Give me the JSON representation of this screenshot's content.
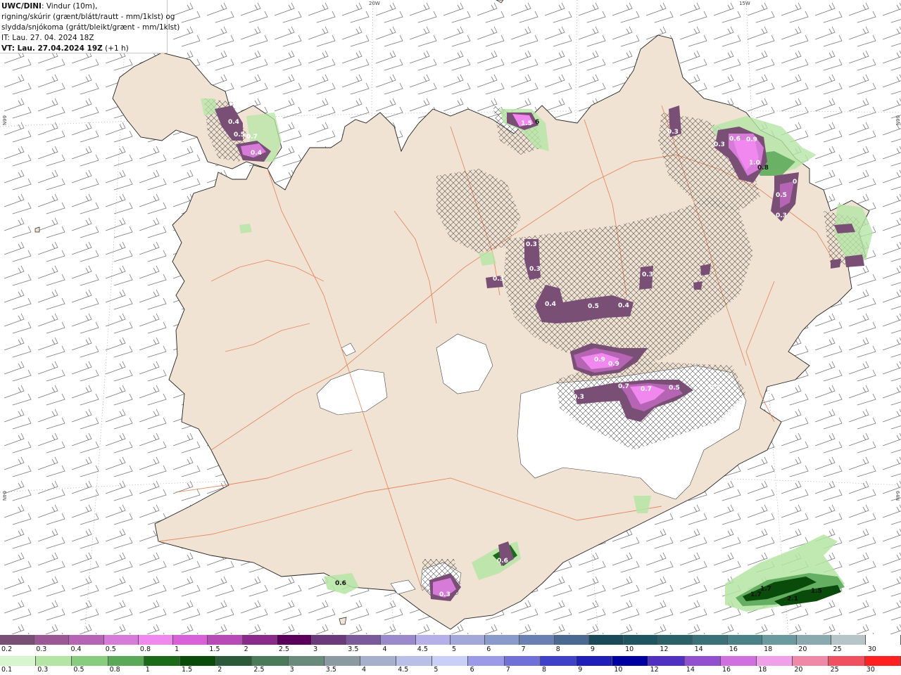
{
  "header": {
    "line1_bold": "UWC/DINI",
    "line1_rest": ": Vindur (10m),",
    "line2": "rigning/skúrir (grænt/blátt/rautt - mm/1klst) og",
    "line3": "slydda/snjókoma (grátt/bleikt/grænt - mm/1klst)",
    "line4": "IT: Lau. 27. 04. 2024 18Z",
    "line5_bold": "VT: Lau. 27.04.2024 19Z",
    "line5_rest": " (+1 h)"
  },
  "grid_labels": {
    "top_20w": "20W",
    "top_15w": "15W",
    "left_66n": "66N",
    "left_64n": "64N",
    "right_66n": "66N",
    "right_64n": "64N"
  },
  "precip_labels": [
    {
      "text": "0.4"
    },
    {
      "text": "0.5"
    },
    {
      "text": "0.7"
    },
    {
      "text": "0.4"
    },
    {
      "text": "1.5"
    },
    {
      "text": "6"
    },
    {
      "text": "0.3"
    },
    {
      "text": "0.3"
    },
    {
      "text": "0.6"
    },
    {
      "text": "0.9"
    },
    {
      "text": "1.0"
    },
    {
      "text": "0.8"
    },
    {
      "text": "0.5"
    },
    {
      "text": "0"
    },
    {
      "text": "0.3"
    },
    {
      "text": "0.3"
    },
    {
      "text": "0.3"
    },
    {
      "text": "0.3"
    },
    {
      "text": "0.4"
    },
    {
      "text": "0.5"
    },
    {
      "text": "0.4"
    },
    {
      "text": "0.3"
    },
    {
      "text": "0.9"
    },
    {
      "text": "0.9"
    },
    {
      "text": "0.7"
    },
    {
      "text": "0.7"
    },
    {
      "text": "0.5"
    },
    {
      "text": "0.3"
    },
    {
      "text": "0.3"
    },
    {
      "text": "0.6"
    },
    {
      "text": "0.3"
    },
    {
      "text": "0.6"
    },
    {
      "text": "1.7"
    },
    {
      "text": "1.7"
    },
    {
      "text": "2.1"
    },
    {
      "text": "1.5"
    }
  ],
  "scale_snow": {
    "labels": [
      "0.2",
      "0.3",
      "0.4",
      "0.5",
      "0.8",
      "1",
      "1.5",
      "2",
      "2.5",
      "3",
      "3.5",
      "4",
      "4.5",
      "5",
      "6",
      "7",
      "8",
      "9",
      "10",
      "12",
      "14",
      "16",
      "18",
      "20",
      "25",
      "30"
    ],
    "colors": [
      "#7a4f76",
      "#9a5894",
      "#b565b3",
      "#d67cd8",
      "#f088f0",
      "#d860d8",
      "#b84ab8",
      "#8a2a8a",
      "#5a005a",
      "#6a3a7a",
      "#7a5a9a",
      "#9a8acb",
      "#b5b0e8",
      "#a2a8d8",
      "#8a9acb",
      "#6a80b0",
      "#4a6890",
      "#1a4a5a",
      "#1f5560",
      "#2a6068",
      "#3a7078",
      "#4a8088",
      "#6a9aa0",
      "#8aaab0",
      "#b5c5c8",
      "#ffffff"
    ]
  },
  "scale_rain": {
    "labels": [
      "0.1",
      "0.3",
      "0.5",
      "0.8",
      "1",
      "1.5",
      "2",
      "2.5",
      "3",
      "3.5",
      "4",
      "4.5",
      "5",
      "6",
      "7",
      "8",
      "9",
      "10",
      "12",
      "14",
      "16",
      "18",
      "20",
      "25",
      "30"
    ],
    "colors": [
      "#d8f5d0",
      "#b5e5a5",
      "#88cc80",
      "#5aa858",
      "#1a6a1a",
      "#0a4a0a",
      "#2a5a3a",
      "#4a7a5a",
      "#6a8a7a",
      "#8a9aa0",
      "#a5b0cc",
      "#b8c0e8",
      "#c8d0f8",
      "#9a9ae8",
      "#7070d8",
      "#4040c8",
      "#2020b8",
      "#0000a0",
      "#5030c0",
      "#9050d0",
      "#d070e0",
      "#f0a0e8",
      "#f088a8",
      "#f05060",
      "#ff2020"
    ]
  }
}
